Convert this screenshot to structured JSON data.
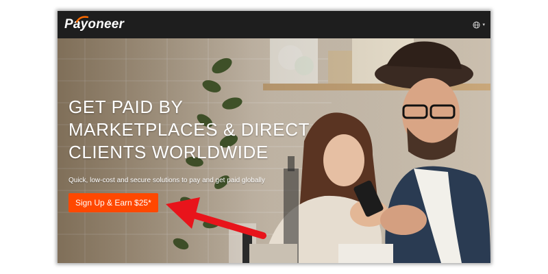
{
  "header": {
    "logo_text": "Payoneer",
    "language_icon": "globe-icon",
    "language_caret": "▾"
  },
  "hero": {
    "headline_lines": [
      "GET PAID BY",
      "MARKETPLACES & DIRECT",
      "CLIENTS WORLDWIDE"
    ],
    "subheadline": "Quick, low-cost and secure solutions to pay and get paid globally",
    "cta_label": "Sign Up & Earn $25*"
  },
  "annotation": {
    "icon": "arrow-pointer-icon",
    "color": "#e8141b"
  },
  "colors": {
    "topbar": "#1e1e1e",
    "brand_orange": "#ff4800",
    "logo_swoosh": "#ff6b00"
  }
}
